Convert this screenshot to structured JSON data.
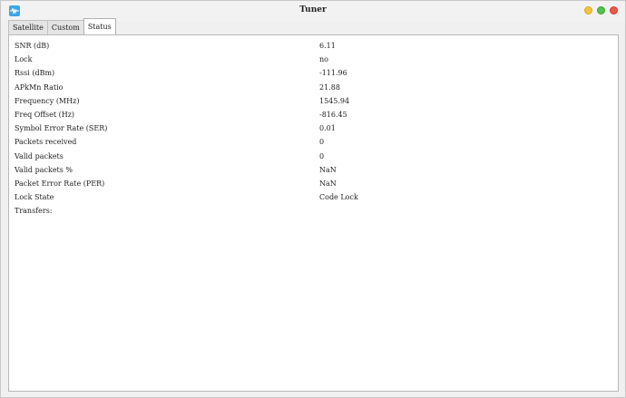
{
  "window": {
    "title": "Tuner",
    "app_icon": "waveform-icon"
  },
  "tabs": [
    {
      "label": "Satellite",
      "active": false
    },
    {
      "label": "Custom",
      "active": false
    },
    {
      "label": "Status",
      "active": true
    }
  ],
  "status": {
    "rows": [
      {
        "label": "SNR (dB)",
        "value": "6.11"
      },
      {
        "label": "Lock",
        "value": "no"
      },
      {
        "label": "Rssi (dBm)",
        "value": "-111.96"
      },
      {
        "label": "APkMn Ratio",
        "value": "21.88"
      },
      {
        "label": "Frequency (MHz)",
        "value": "1545.94"
      },
      {
        "label": "Freq Offset (Hz)",
        "value": "-816.45"
      },
      {
        "label": "Symbol Error Rate (SER)",
        "value": "0.01"
      },
      {
        "label": "Packets received",
        "value": "0"
      },
      {
        "label": "Valid packets",
        "value": "0"
      },
      {
        "label": "Valid packets %",
        "value": "NaN"
      },
      {
        "label": "Packet Error Rate (PER)",
        "value": "NaN"
      },
      {
        "label": "Lock State",
        "value": "Code Lock"
      },
      {
        "label": "Transfers:",
        "value": ""
      }
    ]
  },
  "colors": {
    "minimize": "#f2c43d",
    "maximize": "#53c24a",
    "close": "#f0554a",
    "app_icon": "#3aa6e8"
  }
}
